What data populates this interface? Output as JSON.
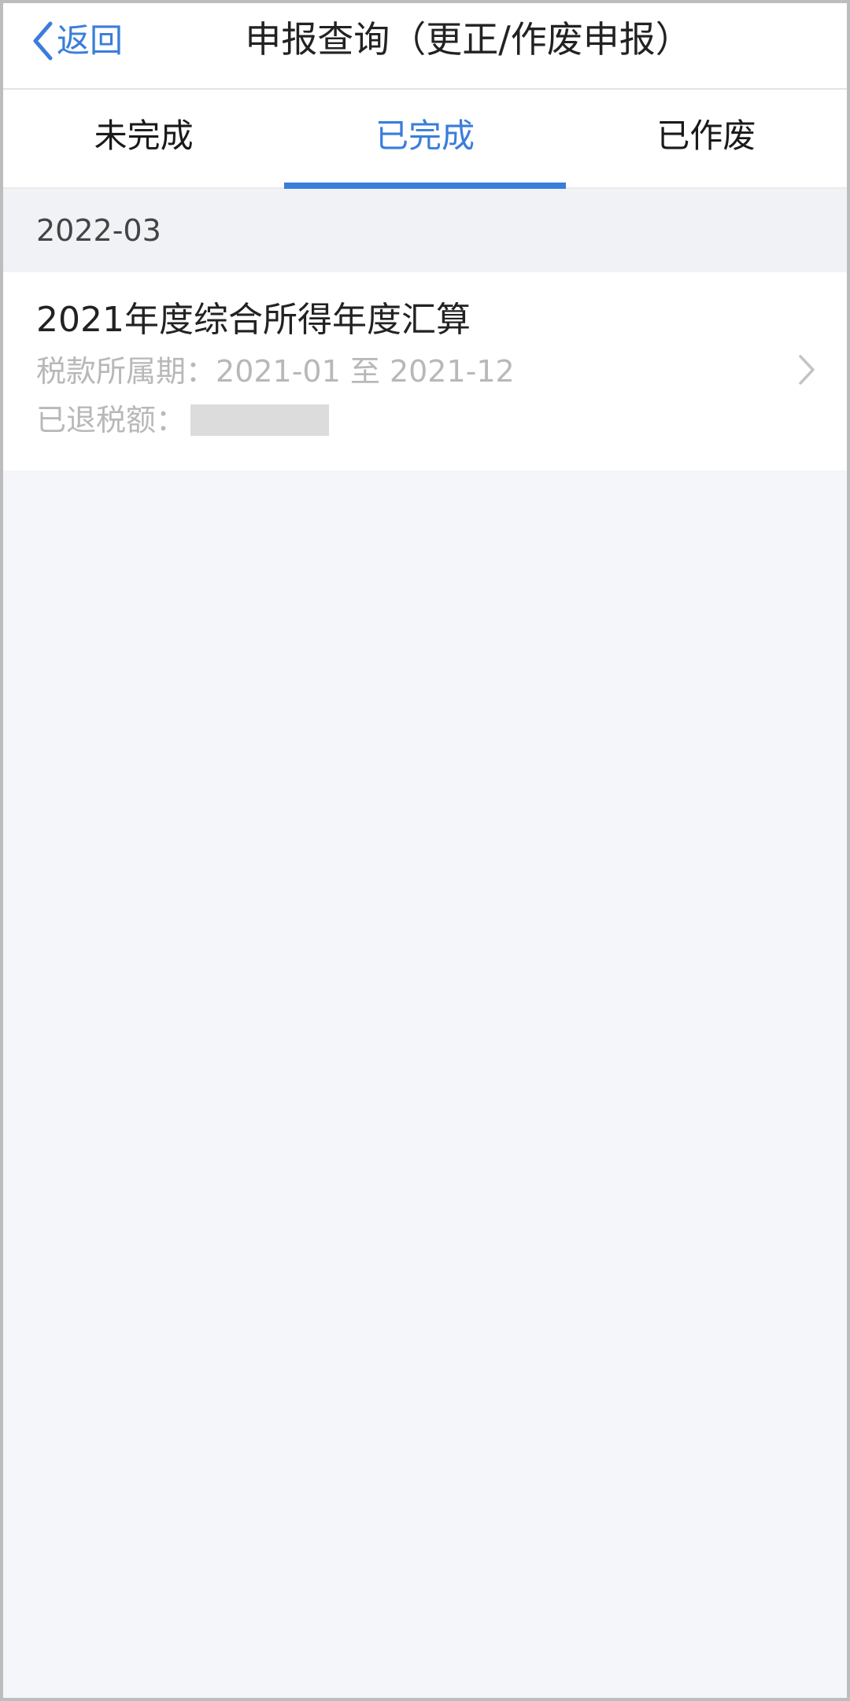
{
  "header": {
    "back_label": "返回",
    "title": "申报查询（更正/作废申报）"
  },
  "tabs": [
    {
      "label": "未完成",
      "active": false
    },
    {
      "label": "已完成",
      "active": true
    },
    {
      "label": "已作废",
      "active": false
    }
  ],
  "sections": [
    {
      "month": "2022-03",
      "items": [
        {
          "title": "2021年度综合所得年度汇算",
          "period_label": "税款所属期：",
          "period_value": "2021-01 至 2021-12",
          "refund_label": "已退税额："
        }
      ]
    }
  ],
  "icons": {
    "back": "chevron-left-icon",
    "row": "chevron-right-icon"
  },
  "colors": {
    "accent": "#3a7ddb",
    "background": "#f4f6fa",
    "muted_text": "#b8b8b8",
    "redacted": "#dcdcdc"
  }
}
